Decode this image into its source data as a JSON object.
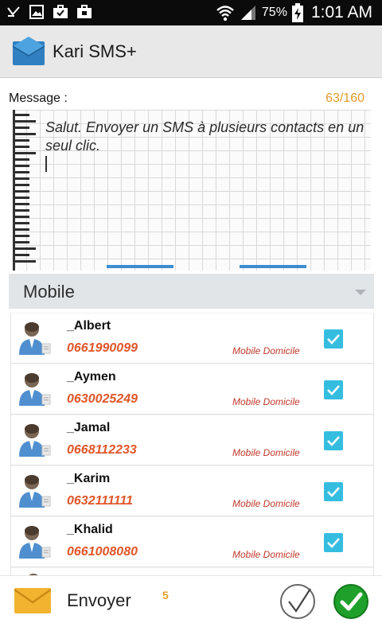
{
  "status_bar": {
    "battery": "75%",
    "time": "1:01 AM"
  },
  "action_bar": {
    "title": "Kari SMS+",
    "logo_icon": "envelope-icon"
  },
  "message": {
    "label": "Message :",
    "counter": "63/160",
    "text": "Salut. Envoyer un SMS à plusieurs contacts en un seul clic."
  },
  "dropdown": {
    "selected": "Mobile"
  },
  "contacts": [
    {
      "name": "_Albert",
      "number": "0661990099",
      "type": "Mobile Domicile",
      "checked": true
    },
    {
      "name": "_Aymen",
      "number": "0630025249",
      "type": "Mobile Domicile",
      "checked": true
    },
    {
      "name": "_Jamal",
      "number": "0668112233",
      "type": "Mobile Domicile",
      "checked": true
    },
    {
      "name": "_Karim",
      "number": "0632111111",
      "type": "Mobile Domicile",
      "checked": true
    },
    {
      "name": "_Khalid",
      "number": "0661008080",
      "type": "Mobile Domicile",
      "checked": true
    }
  ],
  "bottom_bar": {
    "send_label": "Envoyer",
    "count": "5"
  },
  "colors": {
    "accent_orange": "#e29a2b",
    "number_orange": "#e0562a",
    "check_blue": "#35bde0",
    "confirm_green": "#1fa02b"
  }
}
